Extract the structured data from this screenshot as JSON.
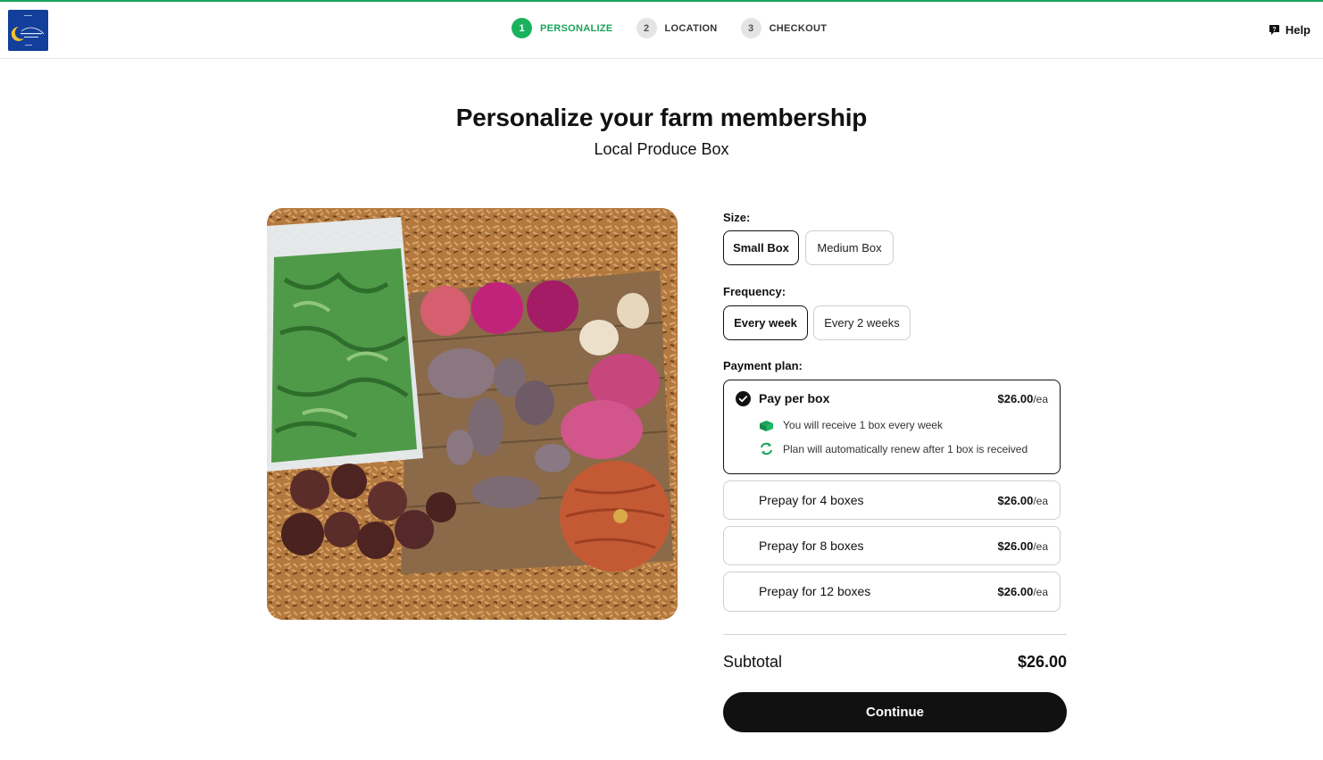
{
  "header": {
    "logo_alt": "Day Dream Farms",
    "steps": [
      {
        "number": "1",
        "label": "PERSONALIZE",
        "active": true
      },
      {
        "number": "2",
        "label": "LOCATION",
        "active": false
      },
      {
        "number": "3",
        "label": "CHECKOUT",
        "active": false
      }
    ],
    "help_label": "Help"
  },
  "page": {
    "title": "Personalize your farm membership",
    "subtitle": "Local Produce Box"
  },
  "options": {
    "size_label": "Size:",
    "sizes": [
      {
        "label": "Small Box",
        "selected": true
      },
      {
        "label": "Medium Box",
        "selected": false
      }
    ],
    "frequency_label": "Frequency:",
    "frequencies": [
      {
        "label": "Every week",
        "selected": true
      },
      {
        "label": "Every 2 weeks",
        "selected": false
      }
    ],
    "payment_label": "Payment plan:",
    "plans": [
      {
        "name": "Pay per box",
        "price": "$26.00",
        "unit": "/ea",
        "selected": true,
        "details": [
          {
            "icon": "box-icon",
            "text": "You will receive 1 box every week"
          },
          {
            "icon": "renew-icon",
            "text": "Plan will automatically renew after 1 box is received"
          }
        ]
      },
      {
        "name": "Prepay for 4 boxes",
        "price": "$26.00",
        "unit": "/ea",
        "selected": false
      },
      {
        "name": "Prepay for 8 boxes",
        "price": "$26.00",
        "unit": "/ea",
        "selected": false
      },
      {
        "name": "Prepay for 12 boxes",
        "price": "$26.00",
        "unit": "/ea",
        "selected": false
      }
    ]
  },
  "summary": {
    "subtotal_label": "Subtotal",
    "subtotal_value": "$26.00",
    "continue_label": "Continue"
  },
  "colors": {
    "accent": "#1aa35b",
    "primary_button": "#111111",
    "border": "#cfcfcf"
  }
}
